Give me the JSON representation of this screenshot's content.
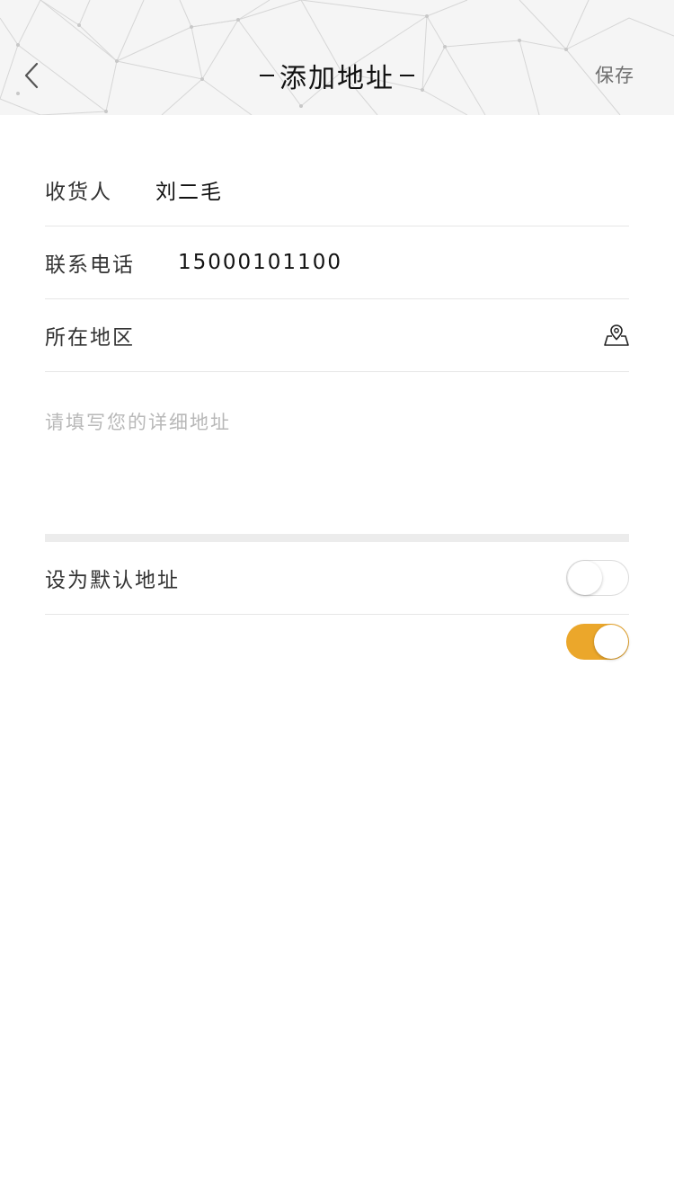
{
  "header": {
    "title": "添加地址",
    "save_label": "保存"
  },
  "form": {
    "recipient": {
      "label": "收货人",
      "value": "刘二毛"
    },
    "phone": {
      "label": "联系电话",
      "value": "15000101100"
    },
    "region": {
      "label": "所在地区",
      "icon": "map-pin-icon"
    },
    "detail": {
      "placeholder": "请填写您的详细地址"
    },
    "default_address": {
      "label": "设为默认地址",
      "enabled": false
    },
    "secondary_toggle": {
      "enabled": true
    }
  },
  "colors": {
    "accent": "#eba72b",
    "header_bg": "#f5f5f5",
    "divider": "#e6e6e6",
    "placeholder": "#b8b8b8"
  }
}
